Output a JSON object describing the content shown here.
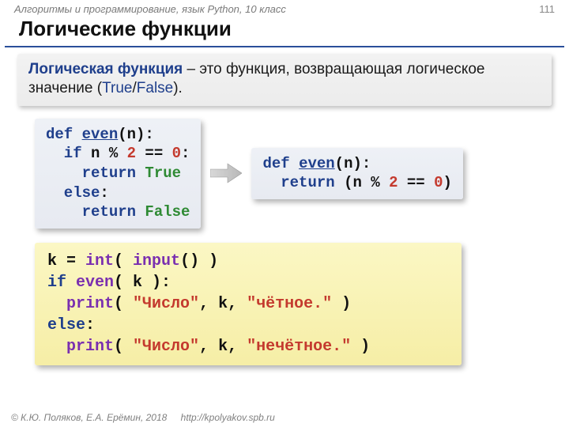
{
  "header": {
    "course": "Алгоритмы и программирование, язык Python, 10 класс",
    "page": "111"
  },
  "title": "Логические функции",
  "definition": {
    "term": "Логическая функция",
    "dash": " – ",
    "body1": "это функция, возвращающая логическое значение (",
    "true": "True",
    "slash": "/",
    "false": "False",
    "body2": ")."
  },
  "code_left": {
    "l1_def": "def ",
    "l1_fn": "even",
    "l1_rest": "(n):",
    "l2_if": "  if",
    "l2_mid": " n % ",
    "l2_two": "2",
    "l2_eq": " == ",
    "l2_zero": "0",
    "l2_colon": ":",
    "l3_ret": "    return ",
    "l3_true": "True",
    "l4_else": "  else",
    "l4_colon": ":",
    "l5_ret": "    return ",
    "l5_false": "False"
  },
  "code_right": {
    "l1_def": "def ",
    "l1_fn": "even",
    "l1_rest": "(n):",
    "l2_ret": "  return ",
    "l2_open": "(n % ",
    "l2_two": "2",
    "l2_eq": " == ",
    "l2_zero": "0",
    "l2_close": ")"
  },
  "code_usage": {
    "l1_a": "k = ",
    "l1_int": "int",
    "l1_b": "( ",
    "l1_input": "input",
    "l1_c": "() )",
    "l2_if": "if",
    "l2_sp": " ",
    "l2_even": "even",
    "l2_b": "( k ):",
    "l3_sp": "  ",
    "l3_print": "print",
    "l3_a": "( ",
    "l3_s1": "\"Число\"",
    "l3_b": ", k, ",
    "l3_s2": "\"чётное.\"",
    "l3_c": " )",
    "l4_else": "else",
    "l4_colon": ":",
    "l5_sp": "  ",
    "l5_print": "print",
    "l5_a": "( ",
    "l5_s1": "\"Число\"",
    "l5_b": ", k, ",
    "l5_s2": "\"нечётное.\"",
    "l5_c": " )"
  },
  "footer": {
    "copyright": "© К.Ю. Поляков, Е.А. Ерёмин, 2018",
    "url": "http://kpolyakov.spb.ru"
  }
}
